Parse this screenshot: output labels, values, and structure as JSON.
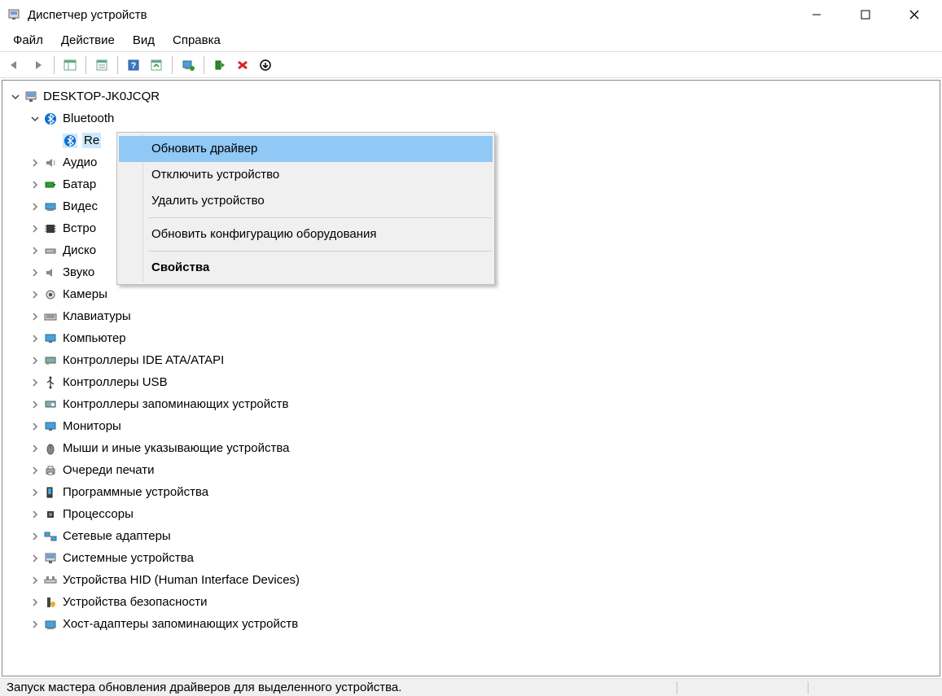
{
  "window": {
    "title": "Диспетчер устройств"
  },
  "menu": {
    "file": "Файл",
    "action": "Действие",
    "view": "Вид",
    "help": "Справка"
  },
  "tree": {
    "root": "DESKTOP-JK0JCQR",
    "bluetooth": "Bluetooth",
    "bluetooth_item_partial": "Re",
    "items": [
      "Аудио",
      "Батар",
      "Видес",
      "Встро",
      "Диско",
      "Звуко",
      "Камеры",
      "Клавиатуры",
      "Компьютер",
      "Контроллеры IDE ATA/ATAPI",
      "Контроллеры USB",
      "Контроллеры запоминающих устройств",
      "Мониторы",
      "Мыши и иные указывающие устройства",
      "Очереди печати",
      "Программные устройства",
      "Процессоры",
      "Сетевые адаптеры",
      "Системные устройства",
      "Устройства HID (Human Interface Devices)",
      "Устройства безопасности",
      "Хост-адаптеры запоминающих устройств"
    ]
  },
  "context_menu": {
    "update_driver": "Обновить драйвер",
    "disable_device": "Отключить устройство",
    "delete_device": "Удалить устройство",
    "refresh_config": "Обновить конфигурацию оборудования",
    "properties": "Свойства"
  },
  "statusbar": {
    "text": "Запуск мастера обновления драйверов для выделенного устройства."
  }
}
